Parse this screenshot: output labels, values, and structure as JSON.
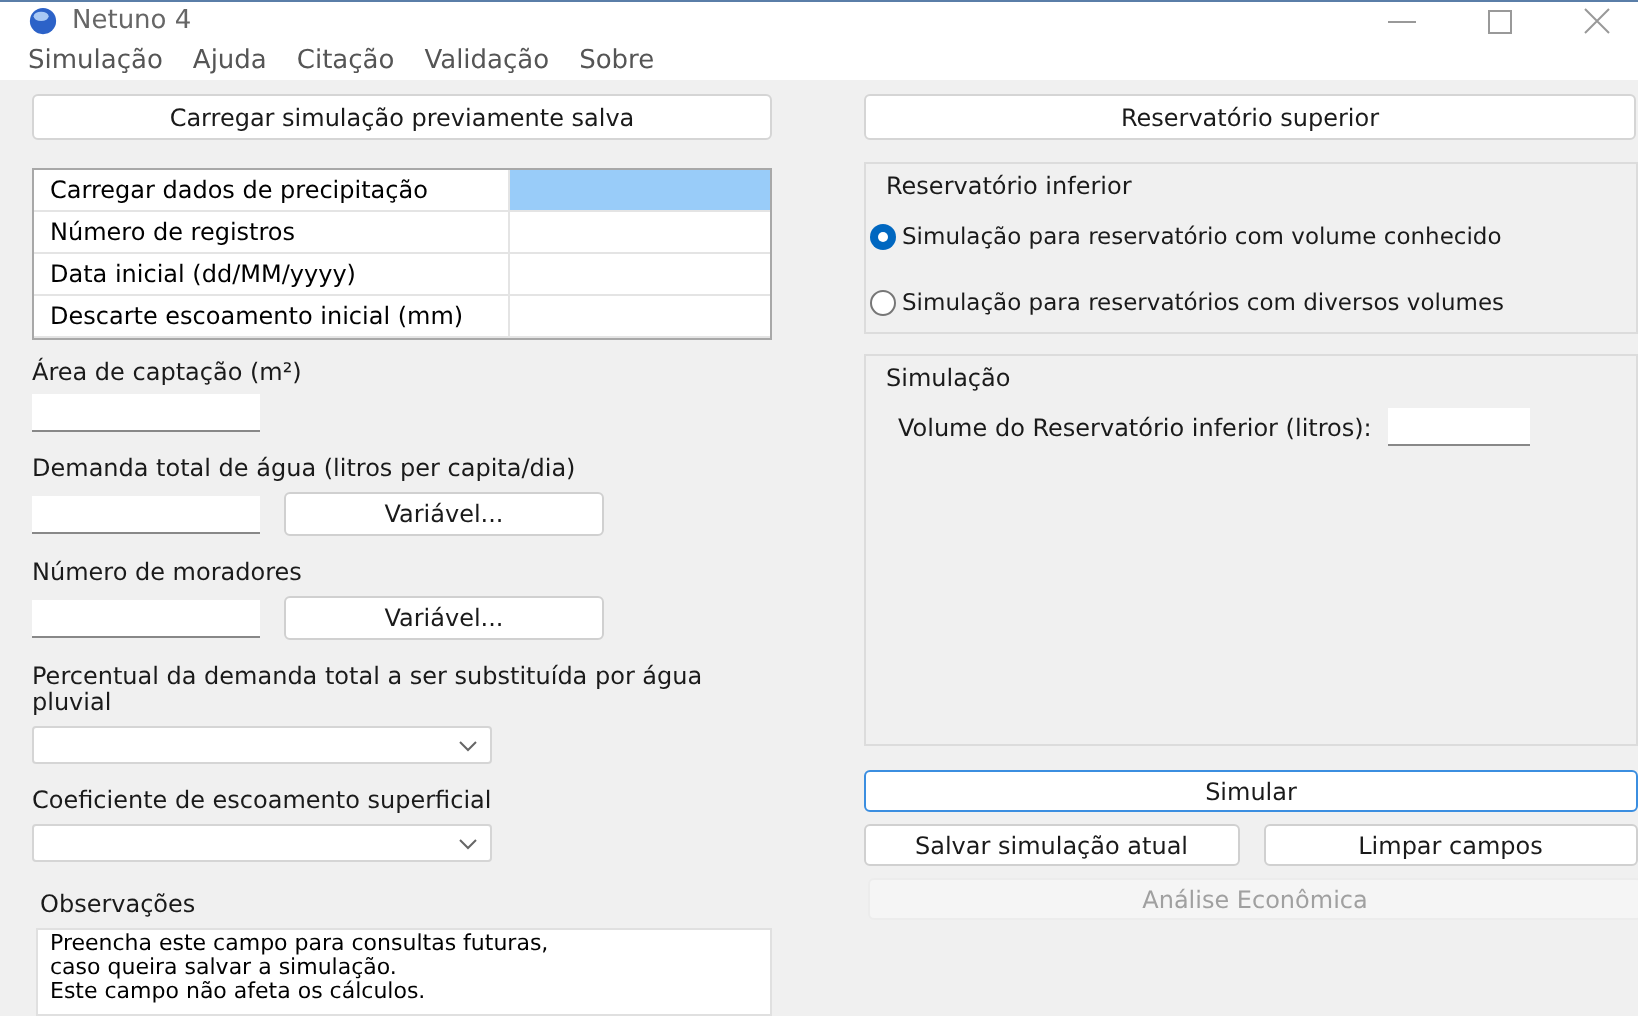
{
  "window": {
    "title": "Netuno 4"
  },
  "menu": [
    "Simulação",
    "Ajuda",
    "Citação",
    "Validação",
    "Sobre"
  ],
  "load_button": "Carregar simulação previamente salva",
  "data_table": [
    {
      "label": "Carregar dados de precipitação",
      "selected": true
    },
    {
      "label": "Número de registros",
      "selected": false
    },
    {
      "label": "Data inicial (dd/MM/yyyy)",
      "selected": false
    },
    {
      "label": "Descarte escoamento inicial (mm)",
      "selected": false
    }
  ],
  "fields": [
    {
      "kind": "input",
      "label": "Área de captação (m²)"
    },
    {
      "kind": "input_button",
      "label": "Demanda total de água (litros per capita/dia)",
      "button": "Variável..."
    },
    {
      "kind": "input_button",
      "label": "Número de moradores",
      "button": "Variável..."
    },
    {
      "kind": "combo",
      "label": "Percentual da demanda total a ser substituída por água pluvial"
    },
    {
      "kind": "combo",
      "label": "Coeficiente de escoamento superficial"
    }
  ],
  "notes": {
    "label": "Observações",
    "text": "Preencha este campo para consultas futuras,\ncaso queira salvar a simulação.\nEste campo não afeta os cálculos."
  },
  "upper_button": "Reservatório superior",
  "lower_group": {
    "title": "Reservatório inferior",
    "options": [
      {
        "label": "Simulação para reservatório com volume conhecido",
        "selected": true
      },
      {
        "label": "Simulação para reservatórios com diversos volumes",
        "selected": false
      }
    ]
  },
  "simulation_group": {
    "title": "Simulação",
    "volume_label": "Volume do Reservatório inferior (litros):"
  },
  "buttons": [
    {
      "label": "Simular",
      "focused": true,
      "disabled": false
    },
    {
      "label": "Salvar simulação atual",
      "focused": false,
      "disabled": false
    },
    {
      "label": "Limpar campos",
      "focused": false,
      "disabled": false
    },
    {
      "label": "Análise Econômica",
      "focused": false,
      "disabled": true
    }
  ]
}
